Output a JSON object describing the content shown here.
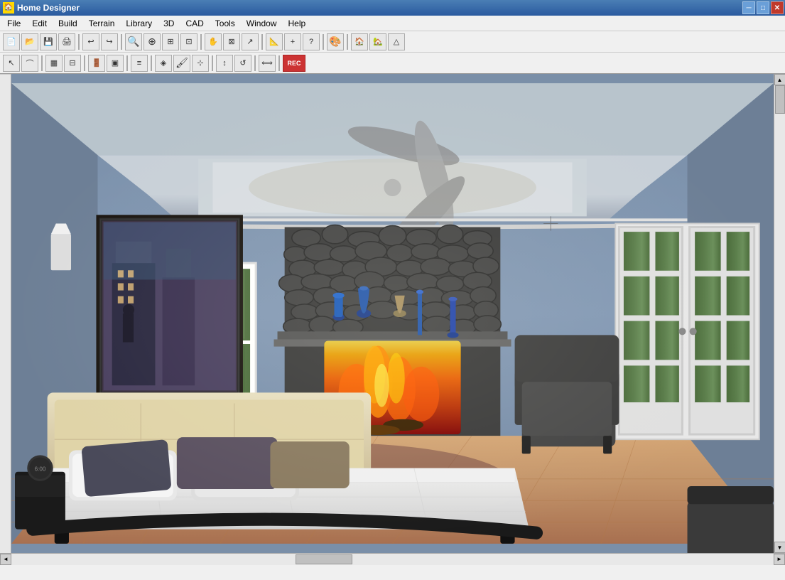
{
  "titleBar": {
    "title": "Home Designer",
    "icon": "🏠",
    "controls": {
      "minimize": "─",
      "maximize": "□",
      "close": "✕"
    }
  },
  "menuBar": {
    "items": [
      "File",
      "Edit",
      "Build",
      "Terrain",
      "Library",
      "3D",
      "CAD",
      "Tools",
      "Window",
      "Help"
    ]
  },
  "toolbar1": {
    "buttons": [
      {
        "name": "new",
        "icon": "📄"
      },
      {
        "name": "open",
        "icon": "📂"
      },
      {
        "name": "save",
        "icon": "💾"
      },
      {
        "name": "print",
        "icon": "🖨"
      },
      {
        "name": "undo",
        "icon": "↩"
      },
      {
        "name": "redo",
        "icon": "↪"
      },
      {
        "name": "zoom-out-btn",
        "icon": "🔍"
      },
      {
        "name": "zoom-in-btn",
        "icon": "🔎"
      },
      {
        "name": "zoom-fit",
        "icon": "⊞"
      },
      {
        "name": "zoom-custom",
        "icon": "⊡"
      },
      {
        "name": "pan",
        "icon": "✋"
      },
      {
        "name": "select-all",
        "icon": "⊠"
      },
      {
        "name": "arrow",
        "icon": "↗"
      },
      {
        "name": "measure",
        "icon": "📏"
      },
      {
        "name": "help",
        "icon": "?"
      },
      {
        "name": "materials",
        "icon": "🎨"
      },
      {
        "name": "house",
        "icon": "🏠"
      },
      {
        "name": "house2",
        "icon": "🏡"
      },
      {
        "name": "roof",
        "icon": "△"
      }
    ]
  },
  "toolbar2": {
    "buttons": [
      {
        "name": "select",
        "icon": "↖"
      },
      {
        "name": "arc",
        "icon": "⌒"
      },
      {
        "name": "line",
        "icon": "—"
      },
      {
        "name": "wall",
        "icon": "▦"
      },
      {
        "name": "door",
        "icon": "🚪"
      },
      {
        "name": "cabinet",
        "icon": "▣"
      },
      {
        "name": "stairs",
        "icon": "≡"
      },
      {
        "name": "material",
        "icon": "◈"
      },
      {
        "name": "color",
        "icon": "🎨"
      },
      {
        "name": "paint",
        "icon": "🖌"
      },
      {
        "name": "texture",
        "icon": "⊹"
      },
      {
        "name": "move",
        "icon": "↕"
      },
      {
        "name": "rotate",
        "icon": "↺"
      },
      {
        "name": "rec",
        "icon": "⏺"
      }
    ]
  },
  "statusBar": {
    "text": ""
  },
  "scene": {
    "description": "3D bedroom rendering with fireplace, bed, and windows"
  }
}
